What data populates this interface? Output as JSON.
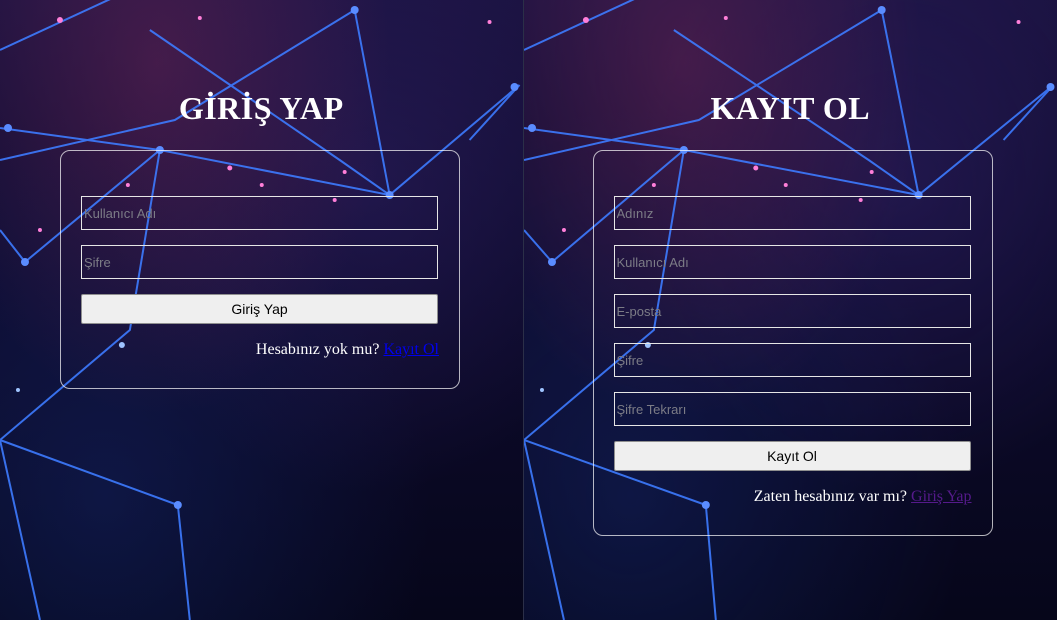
{
  "login": {
    "title": "GİRİŞ YAP",
    "username_placeholder": "Kullanıcı Adı",
    "password_placeholder": "Şifre",
    "submit_label": "Giriş Yap",
    "prompt_text": "Hesabınız yok mu?",
    "link_text": "Kayıt Ol"
  },
  "register": {
    "title": "KAYIT OL",
    "name_placeholder": "Adınız",
    "username_placeholder": "Kullanıcı Adı",
    "email_placeholder": "E-posta",
    "password_placeholder": "Şifre",
    "password_repeat_placeholder": "Şifre Tekrarı",
    "submit_label": "Kayıt Ol",
    "prompt_text": "Zaten hesabınız var mı?",
    "link_text": "Giriş Yap"
  },
  "colors": {
    "background": "#0b0a24",
    "network_lines": "#3d7bff",
    "unvisited_link": "#0000ee",
    "visited_link": "#551a8b"
  }
}
